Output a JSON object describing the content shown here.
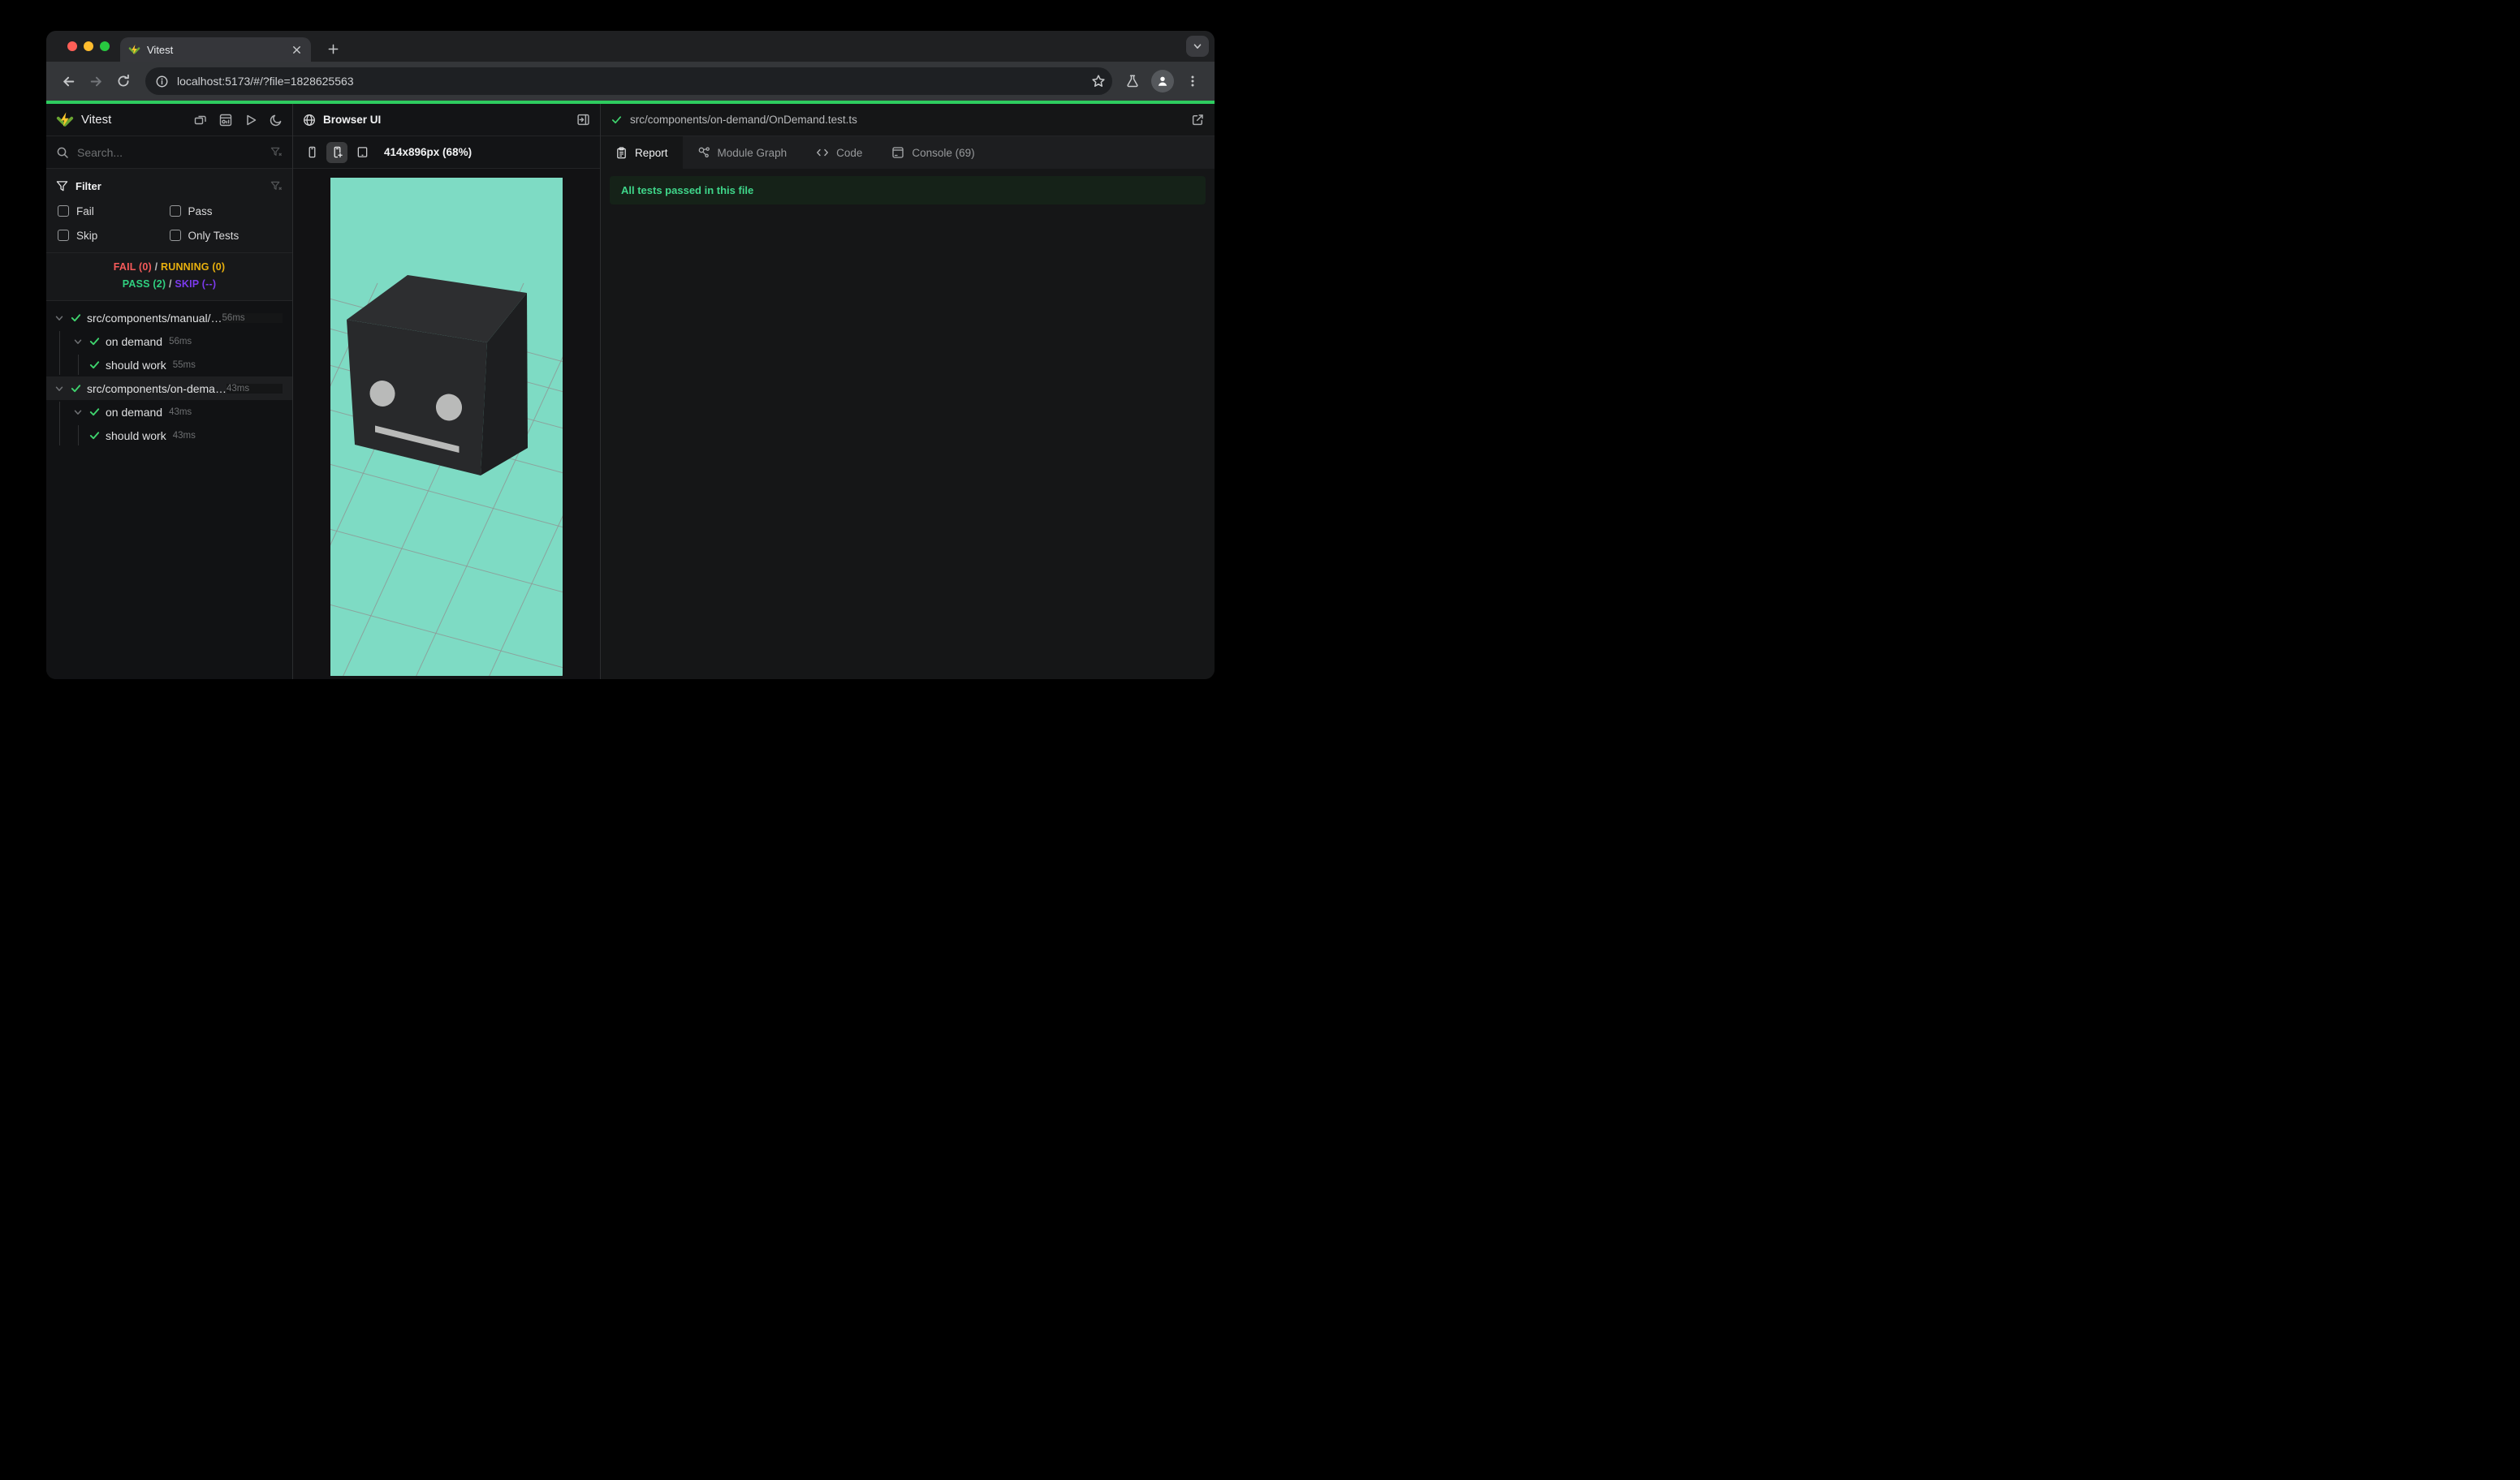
{
  "colors": {
    "accent_green": "#2ecc5f",
    "fail": "#f65a5a",
    "running": "#e8b00e",
    "pass": "#30d080",
    "skip": "#7c3aed",
    "check": "#3fd46e",
    "banner_bg": "#152218",
    "banner_text": "#3fd68a",
    "scene_bg": "#7edbc4",
    "grid_line": "#8f9693",
    "cube_top": "#2d2e30",
    "cube_front": "#28292b",
    "cube_right": "#1d1e20",
    "eye_fill": "#b9bab9",
    "light_close": "#ff5f57",
    "light_min": "#febc2e",
    "light_max": "#28c840"
  },
  "browser": {
    "tab_title": "Vitest",
    "url": "localhost:5173/#/?file=1828625563"
  },
  "sidebar": {
    "app_name": "Vitest",
    "search_placeholder": "Search...",
    "filter": {
      "title": "Filter",
      "fail": "Fail",
      "pass": "Pass",
      "skip": "Skip",
      "only_tests": "Only Tests"
    },
    "summary": {
      "fail": "FAIL (0)",
      "running": "RUNNING (0)",
      "pass": "PASS (2)",
      "skip": "SKIP (--)",
      "separator": "/"
    },
    "tree": [
      {
        "type": "file",
        "name": "src/components/manual/…",
        "duration": "56ms"
      },
      {
        "type": "suite",
        "name": "on demand",
        "duration": "56ms"
      },
      {
        "type": "test",
        "name": "should work",
        "duration": "55ms"
      },
      {
        "type": "file",
        "name": "src/components/on-dema…",
        "duration": "43ms"
      },
      {
        "type": "suite",
        "name": "on demand",
        "duration": "43ms"
      },
      {
        "type": "test",
        "name": "should work",
        "duration": "43ms"
      }
    ]
  },
  "middle": {
    "title": "Browser UI",
    "viewport_label": "414x896px (68%)"
  },
  "right": {
    "file_path": "src/components/on-demand/OnDemand.test.ts",
    "tabs": {
      "report": "Report",
      "module_graph": "Module Graph",
      "code": "Code",
      "console": "Console (69)"
    },
    "banner": "All tests passed in this file"
  }
}
